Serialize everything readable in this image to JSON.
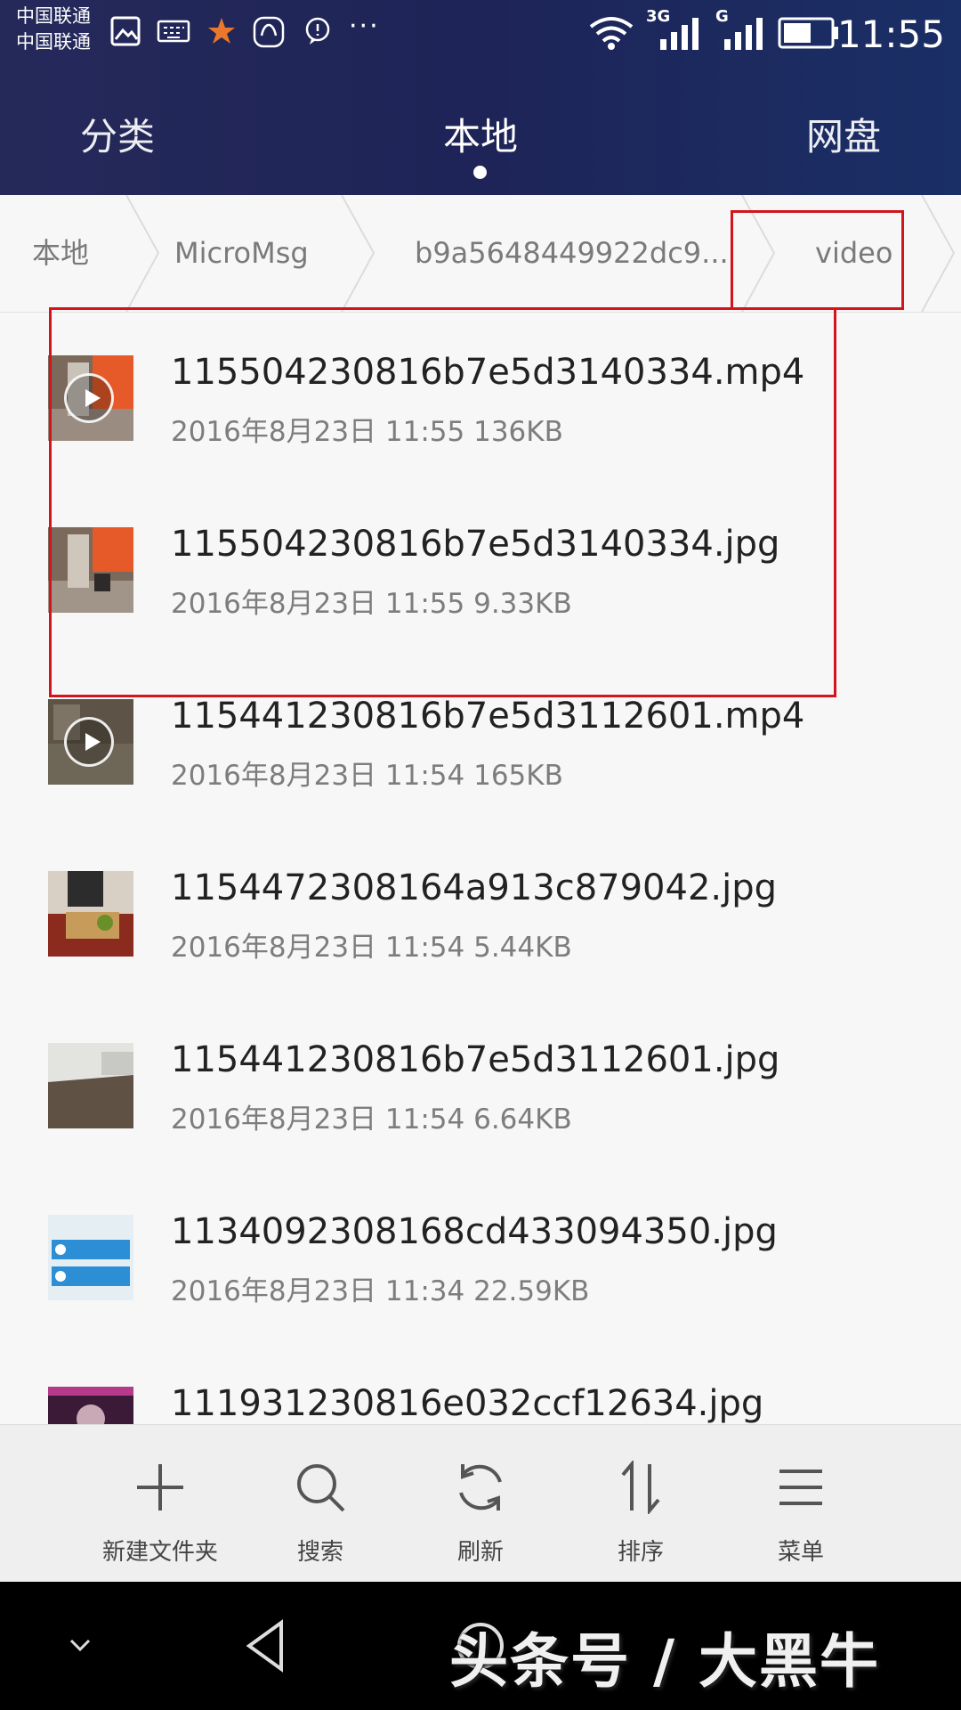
{
  "status_bar": {
    "carrier_1": "中国联通",
    "carrier_2": "中国联通",
    "network_1": "3G",
    "network_2": "G",
    "time": "11:55",
    "more_label": "···"
  },
  "tabs": [
    {
      "label": "分类",
      "active": false
    },
    {
      "label": "本地",
      "active": true
    },
    {
      "label": "网盘",
      "active": false
    }
  ],
  "breadcrumb": [
    "本地",
    "MicroMsg",
    "b9a5648449922dc9...",
    "video"
  ],
  "files": [
    {
      "name": "115504230816b7e5d3140334.mp4",
      "meta": "2016年8月23日 11:55 136KB",
      "type": "video",
      "thumb": "orange-room"
    },
    {
      "name": "115504230816b7e5d3140334.jpg",
      "meta": "2016年8月23日 11:55 9.33KB",
      "type": "image",
      "thumb": "orange-room"
    },
    {
      "name": "115441230816b7e5d3112601.mp4",
      "meta": "2016年8月23日 11:54 165KB",
      "type": "video",
      "thumb": "dim-room"
    },
    {
      "name": "1154472308164a913c879042.jpg",
      "meta": "2016年8月23日 11:54 5.44KB",
      "type": "image",
      "thumb": "cutting-board"
    },
    {
      "name": "115441230816b7e5d3112601.jpg",
      "meta": "2016年8月23日 11:54 6.64KB",
      "type": "image",
      "thumb": "window"
    },
    {
      "name": "1134092308168cd433094350.jpg",
      "meta": "2016年8月23日 11:34 22.59KB",
      "type": "image",
      "thumb": "screenshot"
    },
    {
      "name": "111931230816e032ccf12634.jpg",
      "meta": "",
      "type": "image",
      "thumb": "dark-photo"
    }
  ],
  "toolbar": [
    {
      "label": "新建文件夹",
      "icon": "plus-icon"
    },
    {
      "label": "搜索",
      "icon": "search-icon"
    },
    {
      "label": "刷新",
      "icon": "refresh-icon"
    },
    {
      "label": "排序",
      "icon": "sort-icon"
    },
    {
      "label": "菜单",
      "icon": "menu-icon"
    }
  ],
  "watermark": "头条号 / 大黑牛",
  "colors": {
    "header": "#1e2457",
    "highlight": "#d3141c",
    "list_bg": "#f7f7f7"
  }
}
